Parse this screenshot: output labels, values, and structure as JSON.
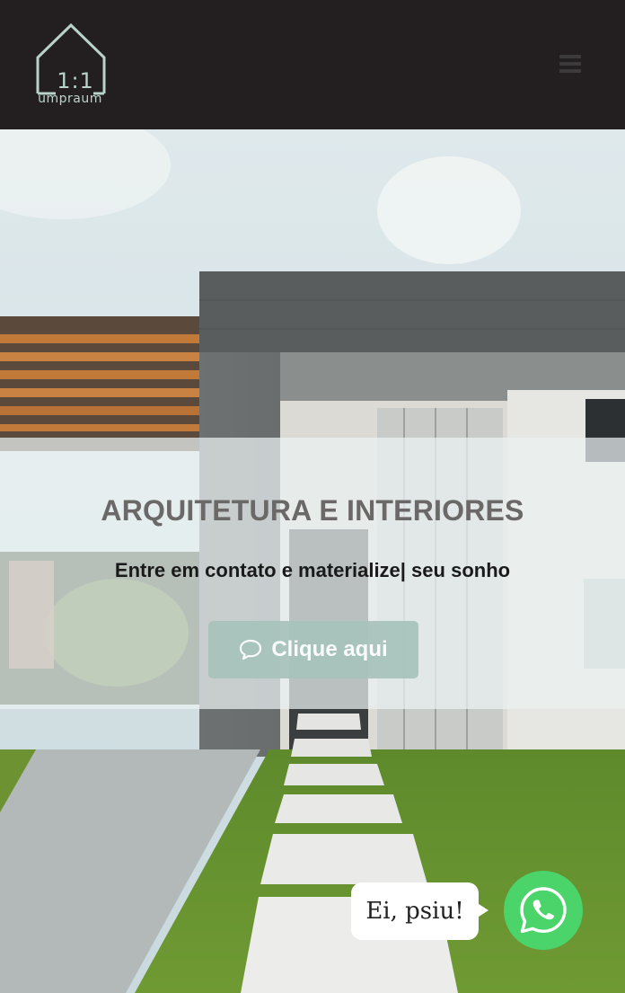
{
  "header": {
    "logo": {
      "number": "1:1",
      "wordmark": "umpraum"
    },
    "menu_icon": "hamburger-icon"
  },
  "hero": {
    "title": "ARQUITETURA E INTERIORES",
    "subtitle": "Entre em contato e materialize| seu sonho",
    "cta_label": "Clique aqui",
    "cta_icon": "speech-bubble-icon"
  },
  "chat": {
    "bubble_text": "Ei, psiu!",
    "button_icon": "whatsapp-icon"
  },
  "colors": {
    "header_bg": "#231f20",
    "logo_color": "#b9d3cc",
    "cta_bg": "#a7c3bc",
    "whatsapp_green": "#4ad46a"
  }
}
